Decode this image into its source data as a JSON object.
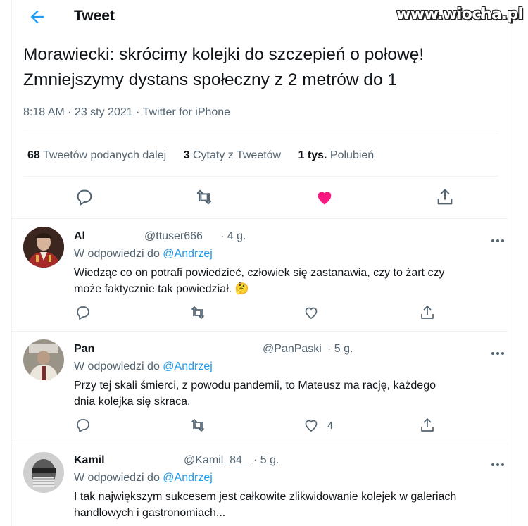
{
  "header": {
    "title": "Tweet"
  },
  "watermark": "www.wiocha.pl",
  "tweet": {
    "line1": "Morawiecki: skrócimy kolejki do szczepień o połowę!",
    "line2": "Zmniejszymy dystans społeczny z 2 metrów do 1",
    "meta": "8:18 AM · 23 sty 2021 · Twitter for iPhone",
    "stats": {
      "retweets_count": "68",
      "retweets_label": "Tweetów podanych dalej",
      "quotes_count": "3",
      "quotes_label": "Cytaty z Tweetów",
      "likes_count": "1 tys.",
      "likes_label": "Polubień"
    }
  },
  "replies": [
    {
      "name": "Al",
      "handle": "@ttuser666",
      "time": "· 4 g.",
      "in_reply_prefix": "W odpowiedzi do",
      "in_reply_mention": "@Andrzej",
      "text_line1": "Wiedząc co on potrafi powiedzieć, człowiek się zastanawia, czy to żart czy",
      "text_line2": "może faktycznie tak powiedział. 🤔",
      "like_count": ""
    },
    {
      "name": "Pan",
      "handle": "@PanPaski",
      "time": "· 5 g.",
      "in_reply_prefix": "W odpowiedzi do",
      "in_reply_mention": "@Andrzej",
      "text_line1": "Przy tej skali śmierci, z powodu pandemii, to Mateusz ma rację,  każdego",
      "text_line2": "dnia kolejka się skraca.",
      "like_count": "4"
    },
    {
      "name": "Kamil",
      "handle": "@Kamil_84_",
      "time": "· 5 g.",
      "in_reply_prefix": "W odpowiedzi do",
      "in_reply_mention": "@Andrzej",
      "text_line1": "I tak największym sukcesem jest całkowite zlikwidowanie kolejek w galeriach",
      "text_line2": "handlowych i gastronomiach...",
      "like_count": ""
    }
  ],
  "colors": {
    "accent": "#1d9bf0",
    "like_active": "#f91880",
    "muted": "#536471"
  }
}
